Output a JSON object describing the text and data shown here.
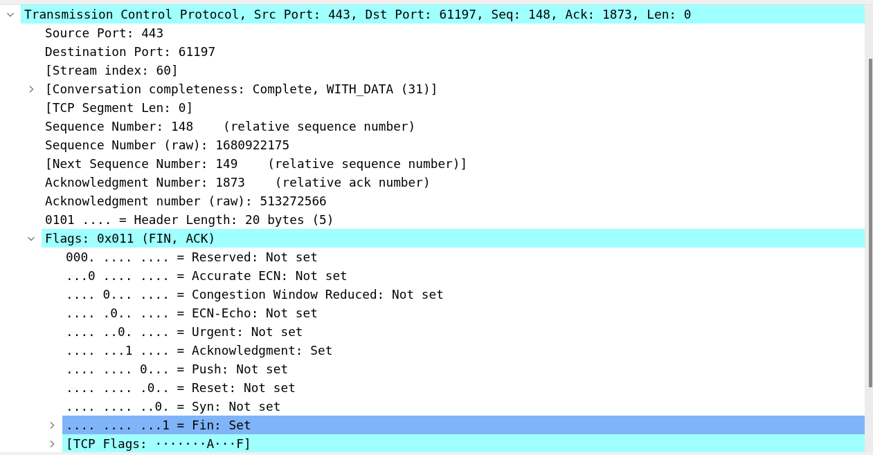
{
  "tree": [
    {
      "label": "Transmission Control Protocol, Src Port: 443, Dst Port: 61197, Seq: 148, Ack: 1873, Len: 0",
      "expanded": true,
      "selected": false,
      "highlighted": true,
      "children": [
        {
          "label": "Source Port: 443",
          "selected": false,
          "highlighted": false
        },
        {
          "label": "Destination Port: 61197",
          "selected": false,
          "highlighted": false
        },
        {
          "label": "[Stream index: 60]",
          "selected": false,
          "highlighted": false
        },
        {
          "label": "[Conversation completeness: Complete, WITH_DATA (31)]",
          "expanded": false,
          "selected": false,
          "highlighted": false
        },
        {
          "label": "[TCP Segment Len: 0]",
          "selected": false,
          "highlighted": false
        },
        {
          "label": "Sequence Number: 148    (relative sequence number)",
          "selected": false,
          "highlighted": false
        },
        {
          "label": "Sequence Number (raw): 1680922175",
          "selected": false,
          "highlighted": false
        },
        {
          "label": "[Next Sequence Number: 149    (relative sequence number)]",
          "selected": false,
          "highlighted": false
        },
        {
          "label": "Acknowledgment Number: 1873    (relative ack number)",
          "selected": false,
          "highlighted": false
        },
        {
          "label": "Acknowledgment number (raw): 513272566",
          "selected": false,
          "highlighted": false
        },
        {
          "label": "0101 .... = Header Length: 20 bytes (5)",
          "selected": false,
          "highlighted": false
        },
        {
          "label": "Flags: 0x011 (FIN, ACK)",
          "expanded": true,
          "selected": false,
          "highlighted": true,
          "children": [
            {
              "label": "000. .... .... = Reserved: Not set",
              "selected": false,
              "highlighted": false
            },
            {
              "label": "...0 .... .... = Accurate ECN: Not set",
              "selected": false,
              "highlighted": false
            },
            {
              "label": ".... 0... .... = Congestion Window Reduced: Not set",
              "selected": false,
              "highlighted": false
            },
            {
              "label": ".... .0.. .... = ECN-Echo: Not set",
              "selected": false,
              "highlighted": false
            },
            {
              "label": ".... ..0. .... = Urgent: Not set",
              "selected": false,
              "highlighted": false
            },
            {
              "label": ".... ...1 .... = Acknowledgment: Set",
              "selected": false,
              "highlighted": false
            },
            {
              "label": ".... .... 0... = Push: Not set",
              "selected": false,
              "highlighted": false
            },
            {
              "label": ".... .... .0.. = Reset: Not set",
              "selected": false,
              "highlighted": false
            },
            {
              "label": ".... .... ..0. = Syn: Not set",
              "selected": false,
              "highlighted": false
            },
            {
              "label": ".... .... ...1 = Fin: Set",
              "expanded": false,
              "selected": true,
              "highlighted": false
            },
            {
              "label": "[TCP Flags: ·······A···F]",
              "expanded": false,
              "selected": false,
              "highlighted": true
            }
          ]
        }
      ]
    }
  ]
}
